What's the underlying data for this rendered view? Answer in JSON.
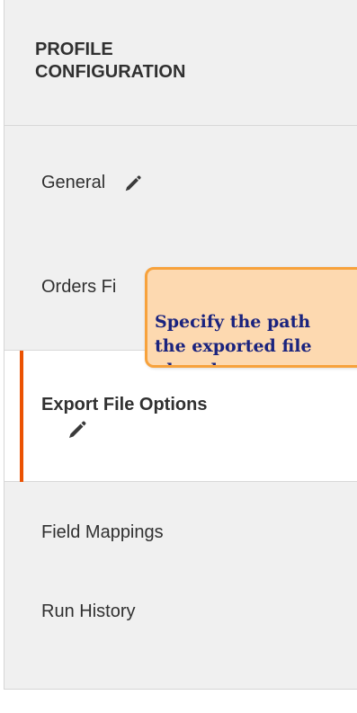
{
  "sidebar": {
    "title": "PROFILE\nCONFIGURATION",
    "items": [
      {
        "label": "General",
        "icon": "pencil-icon"
      },
      {
        "label": "Orders Fi"
      },
      {
        "label": "Export File Options",
        "icon": "pencil-icon",
        "active": true
      },
      {
        "label": "Field Mappings"
      },
      {
        "label": "Run History"
      }
    ]
  },
  "tooltip": {
    "text": "Specify the path\nthe exported file\nplaced."
  },
  "colors": {
    "accent": "#eb5202",
    "tooltip_bg": "#fdd9b0",
    "tooltip_border": "#f7a23c",
    "tooltip_text": "#1a237e"
  }
}
